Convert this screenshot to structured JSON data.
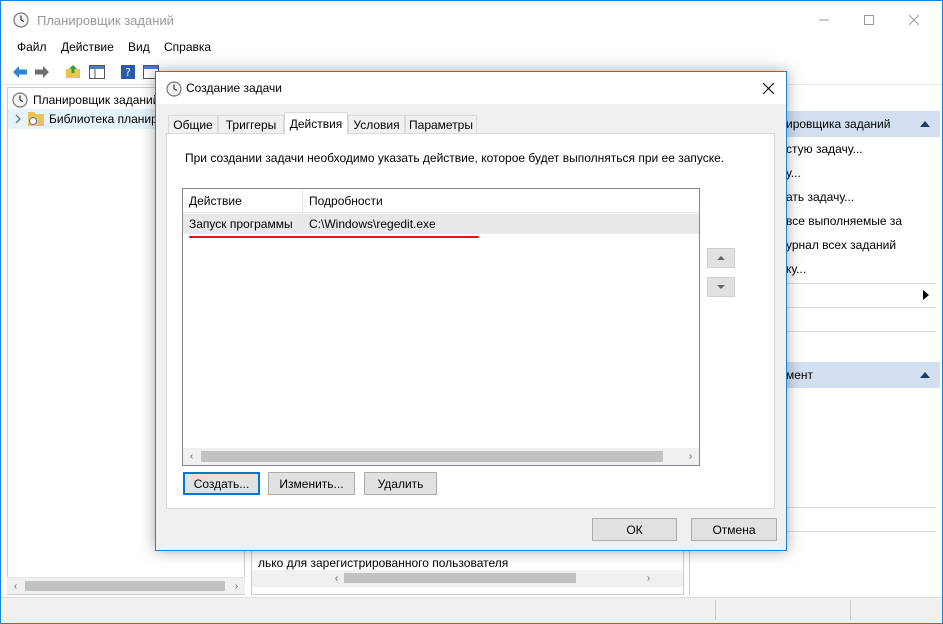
{
  "main": {
    "title": "Планировщик заданий",
    "menu": [
      "Файл",
      "Действие",
      "Вид",
      "Справка"
    ],
    "tree": {
      "root": "Планировщик заданий",
      "library": "Библиотека планир"
    },
    "center_bottom_text": "лько для зарегистрированного пользователя",
    "actions": {
      "header1": "ировщика заданий",
      "items1": [
        "стую задачу...",
        "у...",
        "ать задачу...",
        "все выполняемые за",
        "урнал всех заданий",
        "ку..."
      ],
      "header2": "мент"
    }
  },
  "dialog": {
    "title": "Создание задачи",
    "tabs": [
      "Общие",
      "Триггеры",
      "Действия",
      "Условия",
      "Параметры"
    ],
    "active_tab": "Действия",
    "description": "При создании задачи необходимо указать действие, которое будет выполняться при ее запуске.",
    "columns": [
      "Действие",
      "Подробности"
    ],
    "rows": [
      {
        "action": "Запуск программы",
        "details": "C:\\Windows\\regedit.exe"
      }
    ],
    "buttons": {
      "create": "Создать...",
      "edit": "Изменить...",
      "delete": "Удалить",
      "ok": "ОК",
      "cancel": "Отмена"
    }
  },
  "colors": {
    "accent": "#1883d7",
    "highlight_underline": "#e81123",
    "action_header": "#d2dff0"
  }
}
